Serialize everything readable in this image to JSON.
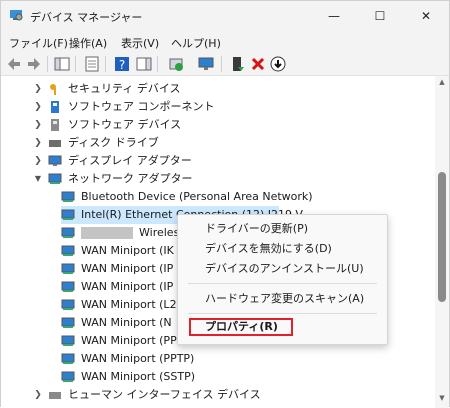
{
  "window": {
    "title": "デバイス マネージャー",
    "controls": {
      "minimize": "—",
      "maximize": "☐",
      "close": "✕"
    }
  },
  "menu": [
    {
      "label": "ファイル(F)"
    },
    {
      "label": "操作(A)"
    },
    {
      "label": "表示(V)"
    },
    {
      "label": "ヘルプ(H)"
    }
  ],
  "toolbar": {
    "buttons": [
      "back-arrow",
      "forward-arrow",
      "show-hide-console-tree",
      "properties",
      "help",
      "show-action-pane",
      "update-driver",
      "scan-hardware",
      "enable-device",
      "uninstall-device",
      "disable-device"
    ]
  },
  "tree": {
    "categories_top": [
      {
        "label": "セキュリティ デバイス",
        "icon": "security-key-icon"
      },
      {
        "label": "ソフトウェア コンポーネント",
        "icon": "software-component-icon"
      },
      {
        "label": "ソフトウェア デバイス",
        "icon": "software-device-icon"
      },
      {
        "label": "ディスク ドライブ",
        "icon": "disk-drive-icon"
      },
      {
        "label": "ディスプレイ アダプター",
        "icon": "display-adapter-icon"
      },
      {
        "label": "ネットワーク アダプター",
        "icon": "network-adapter-icon"
      }
    ],
    "network_children": [
      {
        "label": "Bluetooth Device (Personal Area Network)"
      },
      {
        "label": "Intel(R) Ethernet Connection (12) I219-V",
        "selected": true
      },
      {
        "label": "Wireless L",
        "redacted_prefix": true
      },
      {
        "label": "WAN Miniport (IK"
      },
      {
        "label": "WAN Miniport (IP"
      },
      {
        "label": "WAN Miniport (IP"
      },
      {
        "label": "WAN Miniport (L2"
      },
      {
        "label": "WAN Miniport (N"
      },
      {
        "label": "WAN Miniport (PP"
      },
      {
        "label": "WAN Miniport (PPTP)"
      },
      {
        "label": "WAN Miniport (SSTP)"
      }
    ],
    "category_bottom": {
      "label": "ヒューマン インターフェイス デバイス"
    }
  },
  "context_menu": {
    "items": [
      {
        "label": "ドライバーの更新(P)"
      },
      {
        "label": "デバイスを無効にする(D)"
      },
      {
        "label": "デバイスのアンインストール(U)"
      },
      {
        "label": "ハードウェア変更のスキャン(A)"
      },
      {
        "label": "プロパティ(R)",
        "bold": true,
        "highlighted": true
      }
    ]
  },
  "colors": {
    "selection": "#cce8ff",
    "highlight_box": "#e0202a",
    "chrome": "#f3f3f3"
  }
}
